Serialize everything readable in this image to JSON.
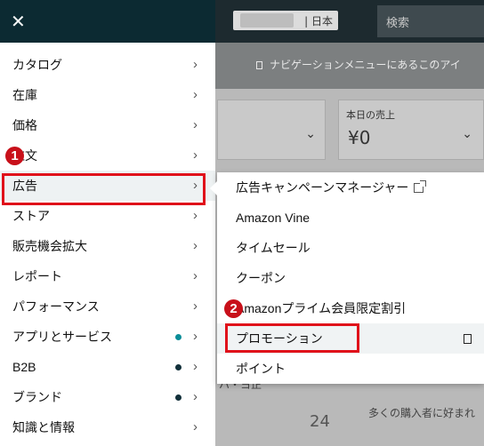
{
  "background": {
    "marketplace_label": "| 日本",
    "search_placeholder": "検索",
    "nav_hint": "ナビゲーションメニューにあるこのアイ",
    "sales_card": {
      "label": "本日の売上",
      "value": "¥0"
    },
    "number_peek": "24",
    "snippet_1": "多くの購入者に好まれ",
    "snippet_2": "ハ・ヨ正"
  },
  "drawer": {
    "close_glyph": "✕",
    "items": [
      {
        "label": "カタログ"
      },
      {
        "label": "在庫"
      },
      {
        "label": "価格"
      },
      {
        "label": "注文"
      },
      {
        "label": "広告"
      },
      {
        "label": "ストア"
      },
      {
        "label": "販売機会拡大"
      },
      {
        "label": "レポート"
      },
      {
        "label": "パフォーマンス"
      },
      {
        "label": "アプリとサービス",
        "dot": "#0a8d98"
      },
      {
        "label": "B2B",
        "dot": "#12303a"
      },
      {
        "label": "ブランド",
        "dot": "#12303a"
      },
      {
        "label": "知識と情報"
      }
    ]
  },
  "flyout": {
    "items": [
      {
        "label": "広告キャンペーンマネージャー",
        "icon": "external-link-icon"
      },
      {
        "label": "Amazon Vine"
      },
      {
        "label": "タイムセール"
      },
      {
        "label": "クーポン"
      },
      {
        "label": "Amazonプライム会員限定割引"
      },
      {
        "label": "プロモーション",
        "icon": "bookmark-icon"
      },
      {
        "label": "ポイント"
      }
    ]
  },
  "callouts": {
    "step1": "1",
    "step2": "2"
  },
  "colors": {
    "drawer_header": "#0c2a32",
    "highlight": "#e0101a",
    "badge": "#c8101a"
  }
}
